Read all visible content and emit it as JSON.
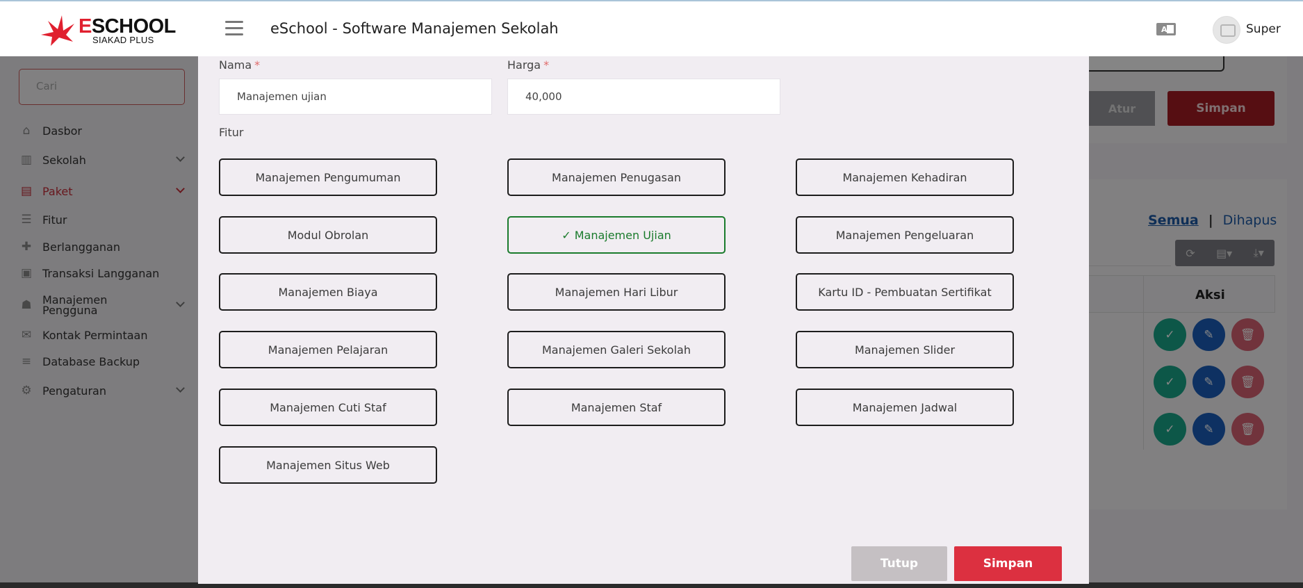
{
  "header": {
    "logo_title_first": "E",
    "logo_title_rest": "SCHOOL",
    "logo_subtitle": "SIAKAD PLUS",
    "app_title": "eSchool - Software Manajemen Sekolah",
    "user_name": "Super"
  },
  "sidebar": {
    "search_placeholder": "Cari",
    "items": [
      {
        "label": "Dasbor",
        "icon": "home-icon"
      },
      {
        "label": "Sekolah",
        "icon": "bank-icon"
      },
      {
        "label": "Paket",
        "icon": "archive-icon"
      },
      {
        "label": "Fitur",
        "icon": "list-icon"
      },
      {
        "label": "Berlangganan",
        "icon": "puzzle-icon"
      },
      {
        "label": "Transaksi Langganan",
        "icon": "money-icon"
      },
      {
        "label": "Manajemen Pengguna",
        "icon": "users-icon"
      },
      {
        "label": "Kontak Permintaan",
        "icon": "envelope-icon"
      },
      {
        "label": "Database Backup",
        "icon": "database-icon"
      },
      {
        "label": "Pengaturan",
        "icon": "gear-icon"
      }
    ]
  },
  "background": {
    "atur_label": "Atur",
    "simpan_label": "Simpan",
    "filter_all": "Semua",
    "filter_separator": "|",
    "filter_deleted": "Dihapus",
    "column_action": "Aksi"
  },
  "modal": {
    "name_label": "Nama",
    "name_value": "Manajemen ujian",
    "price_label": "Harga",
    "price_value": "40,000",
    "features_label": "Fitur",
    "features": [
      {
        "label": "Manajemen Pengumuman",
        "selected": false
      },
      {
        "label": "Manajemen Penugasan",
        "selected": false
      },
      {
        "label": "Manajemen Kehadiran",
        "selected": false
      },
      {
        "label": "Modul Obrolan",
        "selected": false
      },
      {
        "label": "✓ Manajemen Ujian",
        "selected": true
      },
      {
        "label": "Manajemen Pengeluaran",
        "selected": false
      },
      {
        "label": "Manajemen Biaya",
        "selected": false
      },
      {
        "label": "Manajemen Hari Libur",
        "selected": false
      },
      {
        "label": "Kartu ID - Pembuatan Sertifikat",
        "selected": false
      },
      {
        "label": "Manajemen Pelajaran",
        "selected": false
      },
      {
        "label": "Manajemen Galeri Sekolah",
        "selected": false
      },
      {
        "label": "Manajemen Slider",
        "selected": false
      },
      {
        "label": "Manajemen Cuti Staf",
        "selected": false
      },
      {
        "label": "Manajemen Staf",
        "selected": false
      },
      {
        "label": "Manajemen Jadwal",
        "selected": false
      },
      {
        "label": "Manajemen Situs Web",
        "selected": false
      }
    ],
    "close_label": "Tutup",
    "save_label": "Simpan"
  },
  "colors": {
    "brand_red": "#dc3040",
    "selected_green": "#1a7b2c"
  }
}
